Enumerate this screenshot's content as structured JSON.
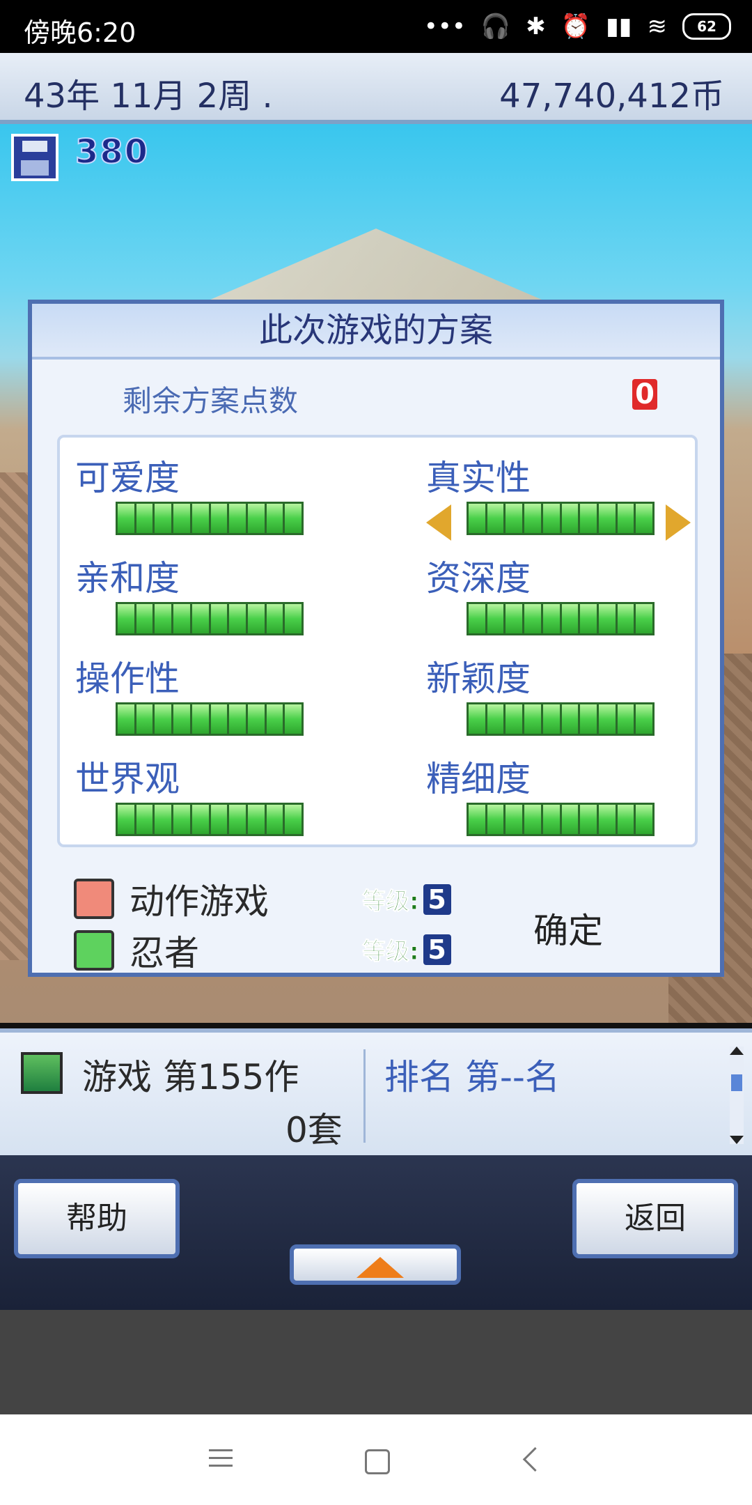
{
  "status": {
    "time": "傍晚6:20",
    "battery": "62"
  },
  "topbar": {
    "date": "43年 11月 2周 .",
    "money": "47,740,412币"
  },
  "scene": {
    "save_count": "380"
  },
  "dialog": {
    "title": "此次游戏的方案",
    "remaining_label": "剩余方案点数",
    "remaining_value": "0",
    "attributes": [
      {
        "label": "可爱度",
        "level": 10
      },
      {
        "label": "真实性",
        "level": 10
      },
      {
        "label": "亲和度",
        "level": 10
      },
      {
        "label": "资深度",
        "level": 10
      },
      {
        "label": "操作性",
        "level": 10
      },
      {
        "label": "新颖度",
        "level": 10
      },
      {
        "label": "世界观",
        "level": 10
      },
      {
        "label": "精细度",
        "level": 10
      }
    ],
    "genres": [
      {
        "name": "动作游戏",
        "level_label": "等级:",
        "level": "5"
      },
      {
        "name": "忍者",
        "level_label": "等级:",
        "level": "5"
      }
    ],
    "confirm": "确定"
  },
  "game_info": {
    "title": "游戏 第155作",
    "sales": "0套",
    "rank": "排名 第--名"
  },
  "buttons": {
    "help": "帮助",
    "back": "返回"
  }
}
